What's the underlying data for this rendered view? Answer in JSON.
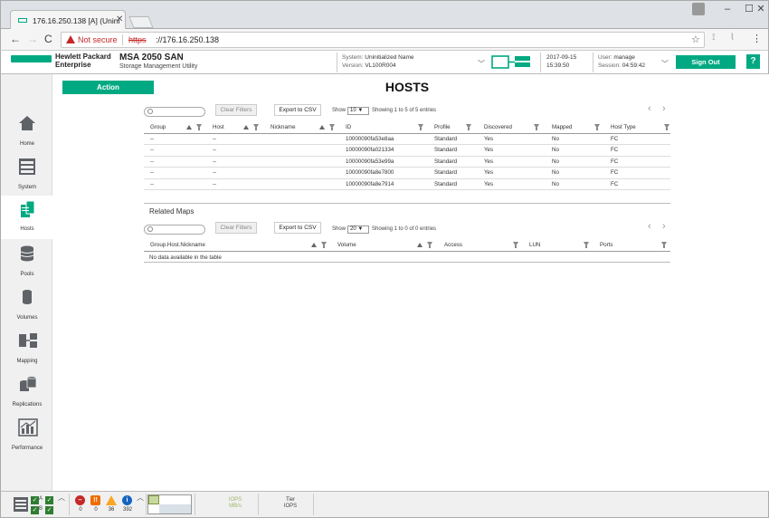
{
  "browser": {
    "tab_title": "176.16.250.138 [A] (Unini",
    "security_label": "Not secure",
    "url_scheme": "https",
    "url_rest": "://176.16.250.138"
  },
  "header": {
    "brand_line1": "Hewlett Packard",
    "brand_line2": "Enterprise",
    "product": "MSA 2050 SAN",
    "product_sub": "Storage Management Utility",
    "system_label": "System:",
    "system_value": "Uninitialized Name",
    "version_label": "Version:",
    "version_value": "VL100R004",
    "date": "2017-09-15",
    "time": "15:39:50",
    "user_label": "User:",
    "user_value": "manage",
    "session_label": "Session:",
    "session_value": "04:59:42",
    "sign_out": "Sign Out",
    "help": "?"
  },
  "sidebar": {
    "items": [
      {
        "label": "Home"
      },
      {
        "label": "System"
      },
      {
        "label": "Hosts"
      },
      {
        "label": "Pools"
      },
      {
        "label": "Volumes"
      },
      {
        "label": "Mapping"
      },
      {
        "label": "Replications"
      },
      {
        "label": "Performance"
      }
    ]
  },
  "main": {
    "action": "Action",
    "title": "HOSTS",
    "hosts_table": {
      "clear_filters": "Clear Filters",
      "export": "Export to CSV",
      "show_label": "Show",
      "show_value": "10 ▼",
      "showing": "Showing 1 to 5 of 5 entries",
      "columns": [
        "Group",
        "Host",
        "Nickname",
        "ID",
        "Profile",
        "Discovered",
        "Mapped",
        "Host Type"
      ],
      "rows": [
        [
          "--",
          "--",
          "",
          "10000090fa53e8aa",
          "Standard",
          "Yes",
          "No",
          "FC"
        ],
        [
          "--",
          "--",
          "",
          "10000090fa021334",
          "Standard",
          "Yes",
          "No",
          "FC"
        ],
        [
          "--",
          "--",
          "",
          "10000090fa53e99a",
          "Standard",
          "Yes",
          "No",
          "FC"
        ],
        [
          "--",
          "--",
          "",
          "10000090fa8e7800",
          "Standard",
          "Yes",
          "No",
          "FC"
        ],
        [
          "--",
          "--",
          "",
          "10000090fa8e7914",
          "Standard",
          "Yes",
          "No",
          "FC"
        ]
      ]
    },
    "maps_table": {
      "title": "Related Maps",
      "clear_filters": "Clear Filters",
      "export": "Export to CSV",
      "show_label": "Show",
      "show_value": "20 ▼",
      "showing": "Showing 1 to 0 of 0 entries",
      "columns": [
        "Group.Host.Nickname",
        "Volume",
        "Access",
        "LUN",
        "Ports"
      ],
      "empty": "No data available in the table"
    }
  },
  "footer": {
    "counts": [
      "0",
      "0",
      "36",
      "392"
    ],
    "status_a": "A",
    "status_b": "B",
    "iops_line1": "IOPS",
    "iops_line2": "MB/s",
    "tier_line1": "Tier",
    "tier_line2": "IOPS"
  },
  "colors": {
    "accent": "#01a982",
    "critical": "#c62828",
    "error": "#ef6c00",
    "warning": "#f9a825",
    "info": "#1565c0"
  }
}
